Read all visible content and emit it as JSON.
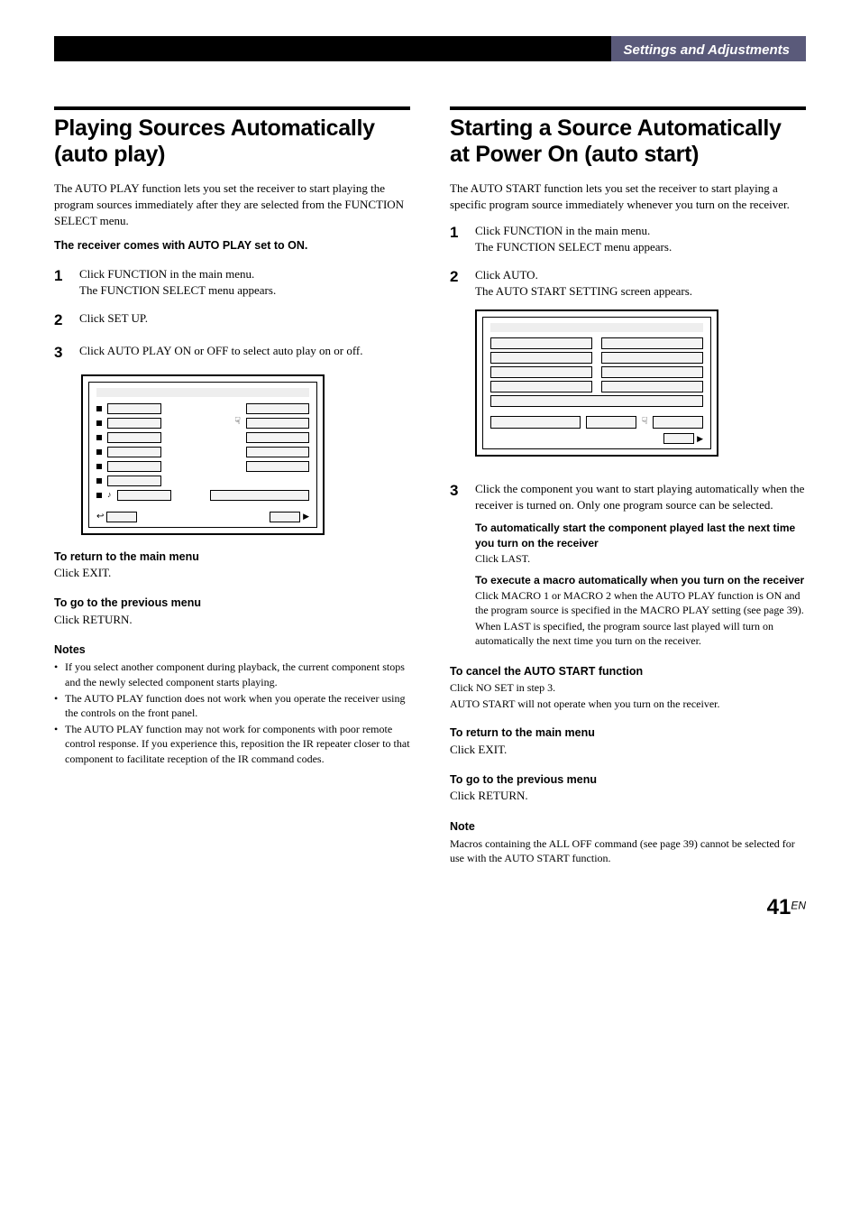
{
  "header": {
    "section_band": "Settings and Adjustments"
  },
  "left": {
    "title": "Playing Sources Automatically (auto play)",
    "intro": "The AUTO PLAY function lets you set the receiver to start playing the program sources immediately after they are selected from the FUNCTION SELECT menu.",
    "default_note": "The receiver comes with AUTO PLAY set to ON.",
    "steps": [
      {
        "num": "1",
        "lines": [
          "Click FUNCTION in the main menu.",
          "The FUNCTION SELECT menu appears."
        ]
      },
      {
        "num": "2",
        "lines": [
          "Click SET UP."
        ]
      },
      {
        "num": "3",
        "lines": [
          "Click AUTO PLAY ON or OFF to select auto play on or off."
        ]
      }
    ],
    "return_heading": "To return to the main menu",
    "return_body": "Click EXIT.",
    "prev_heading": "To go to the previous menu",
    "prev_body": "Click RETURN.",
    "notes_heading": "Notes",
    "notes": [
      "If you select another component during playback, the current component stops and the newly selected component starts playing.",
      "The AUTO PLAY function does not work when you operate the receiver using the controls on the front panel.",
      "The AUTO PLAY function may not work for components with poor remote control response.  If you experience this, reposition the IR repeater closer to that component to facilitate reception of the IR command codes."
    ]
  },
  "right": {
    "title": "Starting a Source Automatically at Power On (auto start)",
    "intro": "The AUTO START function lets you set the receiver to start playing a specific program source immediately whenever you turn on the receiver.",
    "steps": [
      {
        "num": "1",
        "lines": [
          "Click FUNCTION in the main menu.",
          "The FUNCTION SELECT menu appears."
        ]
      },
      {
        "num": "2",
        "lines": [
          "Click AUTO.",
          "The AUTO START SETTING screen appears."
        ]
      },
      {
        "num": "3",
        "lines": [
          "Click the component you want to start playing automatically when the receiver is turned on. Only one program source can be selected."
        ]
      }
    ],
    "auto_last_heading": "To automatically start the component played last the next time you turn on the receiver",
    "auto_last_body": "Click LAST.",
    "macro_heading": "To execute a macro automatically when you turn on the receiver",
    "macro_body1": "Click MACRO 1 or MACRO 2 when the AUTO PLAY function is ON and the program source is specified in the MACRO PLAY setting (see page 39).",
    "macro_body2": "When LAST is specified, the program source last played will turn on automatically the next time you turn on the receiver.",
    "cancel_heading": "To cancel the AUTO START function",
    "cancel_body1": "Click NO SET in step 3.",
    "cancel_body2": "AUTO START will not operate when you turn on the receiver.",
    "return_heading": "To return to the main menu",
    "return_body": "Click EXIT.",
    "prev_heading": "To go to the previous menu",
    "prev_body": "Click RETURN.",
    "note_heading": "Note",
    "note_body": "Macros containing the ALL OFF command  (see page 39) cannot be selected for use with the AUTO START function."
  },
  "icons": {
    "pointer": "☟",
    "return": "↩",
    "forward": "▶"
  },
  "page": {
    "number": "41",
    "suffix": "EN"
  }
}
